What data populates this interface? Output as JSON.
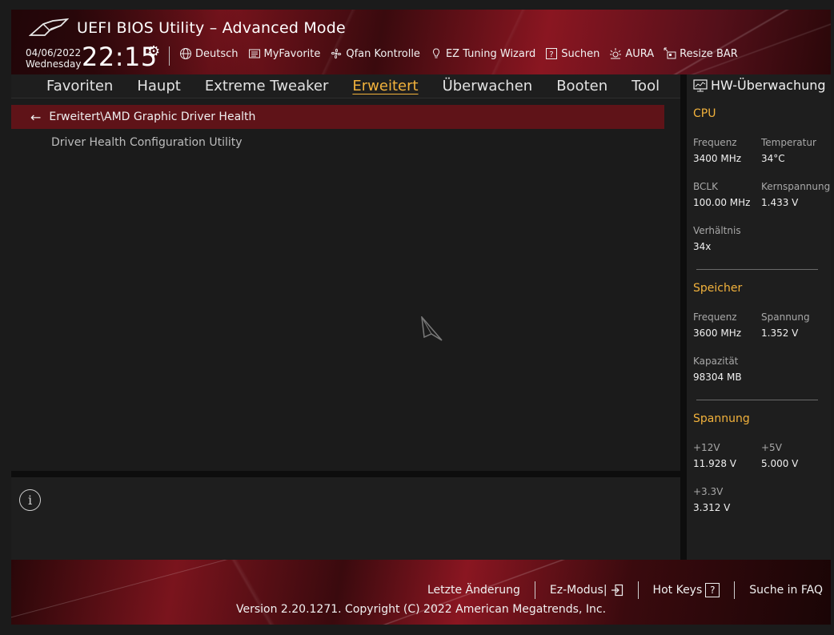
{
  "header": {
    "title": "UEFI BIOS Utility – Advanced Mode",
    "date": "04/06/2022",
    "weekday": "Wednesday",
    "time": "22:15",
    "toolbar": [
      {
        "label": "Deutsch",
        "icon": "globe-icon"
      },
      {
        "label": "MyFavorite",
        "icon": "favorite-icon"
      },
      {
        "label": "Qfan Kontrolle",
        "icon": "fan-icon"
      },
      {
        "label": "EZ Tuning Wizard",
        "icon": "lightbulb-icon"
      },
      {
        "label": "Suchen",
        "icon": "search-help-icon"
      },
      {
        "label": "AURA",
        "icon": "aura-icon"
      },
      {
        "label": "Resize BAR",
        "icon": "resize-bar-icon"
      }
    ]
  },
  "menu": {
    "tabs": [
      "Favoriten",
      "Haupt",
      "Extreme Tweaker",
      "Erweitert",
      "Überwachen",
      "Booten",
      "Tool"
    ],
    "active": "Erweitert"
  },
  "main": {
    "breadcrumb": "Erweitert\\AMD Graphic Driver Health",
    "items": [
      "Driver Health Configuration Utility"
    ]
  },
  "hw": {
    "title": "HW-Überwachung",
    "cpu": {
      "section": "CPU",
      "freq_label": "Frequenz",
      "freq_value": "3400 MHz",
      "temp_label": "Temperatur",
      "temp_value": "34°C",
      "bclk_label": "BCLK",
      "bclk_value": "100.00 MHz",
      "core_label": "Kernspannung",
      "core_value": "1.433 V",
      "ratio_label": "Verhältnis",
      "ratio_value": "34x"
    },
    "memory": {
      "section": "Speicher",
      "freq_label": "Frequenz",
      "freq_value": "3600 MHz",
      "volt_label": "Spannung",
      "volt_value": "1.352 V",
      "cap_label": "Kapazität",
      "cap_value": "98304 MB"
    },
    "voltage": {
      "section": "Spannung",
      "v12_label": "+12V",
      "v12_value": "11.928 V",
      "v5_label": "+5V",
      "v5_value": "5.000 V",
      "v33_label": "+3.3V",
      "v33_value": "3.312 V"
    }
  },
  "footer": {
    "last_change": "Letzte Änderung",
    "ez_mode": "Ez-Modus|",
    "hot_keys": "Hot Keys",
    "hot_keys_key": "?",
    "faq": "Suche in FAQ",
    "version": "Version 2.20.1271. Copyright (C) 2022 American Megatrends, Inc."
  },
  "colors": {
    "accent": "#f2b23c",
    "breadcrumb_bg": "#5f1318",
    "panel_bg": "#1e1e1e"
  }
}
